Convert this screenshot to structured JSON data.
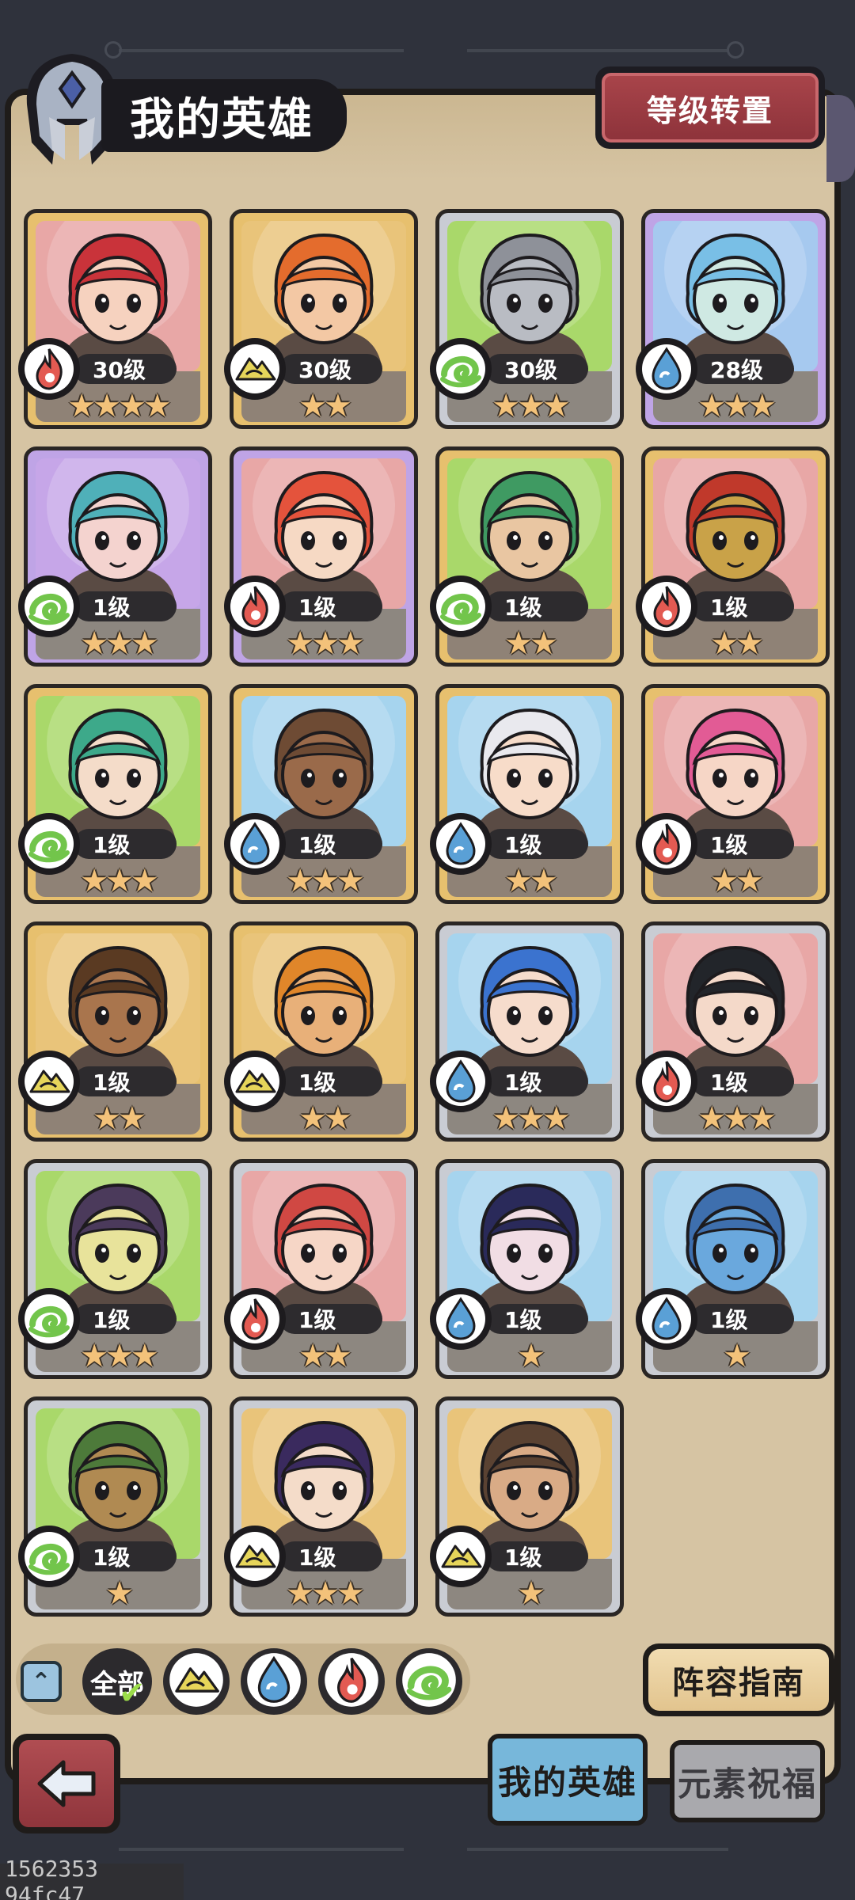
{
  "header": {
    "title": "我的英雄",
    "level_transfer_label": "等级转置"
  },
  "heroes": [
    {
      "level": "30级",
      "stars": "★★★★",
      "element": "fire",
      "frame": "gold",
      "bg": "#e8a7a6",
      "skin": "#f6d2bf",
      "hair": "#c9333a"
    },
    {
      "level": "30级",
      "stars": "★★",
      "element": "earth",
      "frame": "gold",
      "bg": "#e9c47a",
      "skin": "#f3c8a4",
      "hair": "#e46c2d"
    },
    {
      "level": "30级",
      "stars": "★★★",
      "element": "wind",
      "frame": "silver",
      "bg": "#a9d86a",
      "skin": "#b9bcc3",
      "hair": "#8e9199"
    },
    {
      "level": "28级",
      "stars": "★★★",
      "element": "water",
      "frame": "purple",
      "bg": "#a6c9ef",
      "skin": "#cfe9e3",
      "hair": "#79bfe6"
    },
    {
      "level": "1级",
      "stars": "★★★",
      "element": "wind",
      "frame": "purple",
      "bg": "#c6a6e8",
      "skin": "#f4d3cf",
      "hair": "#4fb0b9"
    },
    {
      "level": "1级",
      "stars": "★★★",
      "element": "fire",
      "frame": "purple",
      "bg": "#e8a7a6",
      "skin": "#f6d9c4",
      "hair": "#e4533c"
    },
    {
      "level": "1级",
      "stars": "★★",
      "element": "wind",
      "frame": "gold",
      "bg": "#a9d86a",
      "skin": "#e9c6a2",
      "hair": "#3f9a62"
    },
    {
      "level": "1级",
      "stars": "★★",
      "element": "fire",
      "frame": "gold",
      "bg": "#e8a7a6",
      "skin": "#c9a248",
      "hair": "#c0392b"
    },
    {
      "level": "1级",
      "stars": "★★★",
      "element": "wind",
      "frame": "gold",
      "bg": "#a9d86a",
      "skin": "#f4dcc9",
      "hair": "#3da98a"
    },
    {
      "level": "1级",
      "stars": "★★★",
      "element": "water",
      "frame": "gold",
      "bg": "#a6d4ee",
      "skin": "#9a6a4a",
      "hair": "#6e4b34"
    },
    {
      "level": "1级",
      "stars": "★★",
      "element": "water",
      "frame": "gold",
      "bg": "#a6d4ee",
      "skin": "#f7dcc9",
      "hair": "#e9e9ee"
    },
    {
      "level": "1级",
      "stars": "★★",
      "element": "fire",
      "frame": "gold",
      "bg": "#e8a7a6",
      "skin": "#f6d6c6",
      "hair": "#e25b95"
    },
    {
      "level": "1级",
      "stars": "★★",
      "element": "earth",
      "frame": "gold",
      "bg": "#e9c47a",
      "skin": "#a9754d",
      "hair": "#5a3a22"
    },
    {
      "level": "1级",
      "stars": "★★",
      "element": "earth",
      "frame": "gold",
      "bg": "#e9c47a",
      "skin": "#e8b079",
      "hair": "#e0862a"
    },
    {
      "level": "1级",
      "stars": "★★★",
      "element": "water",
      "frame": "silver",
      "bg": "#a6d4ee",
      "skin": "#f6dccc",
      "hair": "#3b73cf"
    },
    {
      "level": "1级",
      "stars": "★★★",
      "element": "fire",
      "frame": "silver",
      "bg": "#e8a7a6",
      "skin": "#f4d9c9",
      "hair": "#22252a"
    },
    {
      "level": "1级",
      "stars": "★★★",
      "element": "wind",
      "frame": "silver",
      "bg": "#a9d86a",
      "skin": "#e8e39b",
      "hair": "#4b3a5b"
    },
    {
      "level": "1级",
      "stars": "★★",
      "element": "fire",
      "frame": "silver",
      "bg": "#e8a7a6",
      "skin": "#f6d6c6",
      "hair": "#d04843"
    },
    {
      "level": "1级",
      "stars": "★",
      "element": "water",
      "frame": "silver",
      "bg": "#a6d4ee",
      "skin": "#f1dde4",
      "hair": "#2a2a5a"
    },
    {
      "level": "1级",
      "stars": "★",
      "element": "water",
      "frame": "silver",
      "bg": "#a6d4ee",
      "skin": "#6aa8dd",
      "hair": "#3e6fae"
    },
    {
      "level": "1级",
      "stars": "★",
      "element": "wind",
      "frame": "silver",
      "bg": "#a9d86a",
      "skin": "#b08a52",
      "hair": "#4d7a3a"
    },
    {
      "level": "1级",
      "stars": "★★★",
      "element": "earth",
      "frame": "silver",
      "bg": "#e9c47a",
      "skin": "#f4dcc9",
      "hair": "#3a2a5e"
    },
    {
      "level": "1级",
      "stars": "★",
      "element": "earth",
      "frame": "silver",
      "bg": "#e9c47a",
      "skin": "#d9ab86",
      "hair": "#5a4232"
    }
  ],
  "filters": {
    "all_label": "全部",
    "elements": [
      "earth",
      "water",
      "fire",
      "wind"
    ]
  },
  "guide_label": "阵容指南",
  "tabs": {
    "my_heroes": "我的英雄",
    "element_blessing": "元素祝福"
  },
  "watermark": "1562353 94fc47",
  "colors": {
    "fire": "#e35a52",
    "earth": "#e6d55a",
    "water": "#5aa0d6",
    "wind": "#72c54b"
  }
}
